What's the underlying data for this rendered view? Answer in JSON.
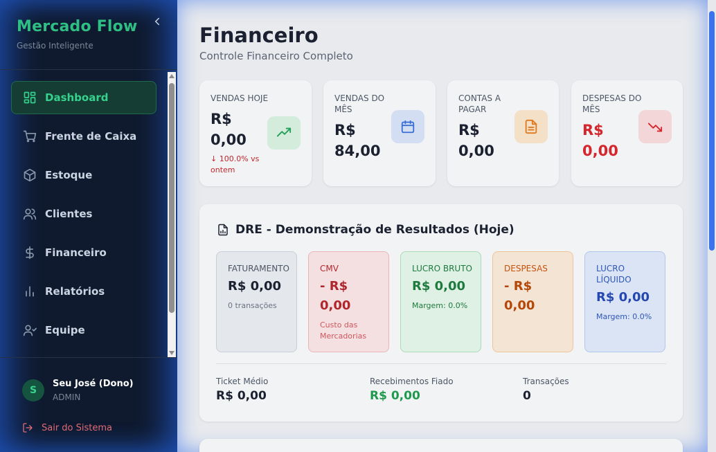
{
  "sidebar": {
    "brand_title": "Mercado Flow",
    "brand_subtitle": "Gestão Inteligente",
    "items": [
      {
        "label": "Dashboard",
        "icon": "dashboard-icon",
        "active": true
      },
      {
        "label": "Frente de Caixa",
        "icon": "cart-icon",
        "active": false
      },
      {
        "label": "Estoque",
        "icon": "box-icon",
        "active": false
      },
      {
        "label": "Clientes",
        "icon": "users-icon",
        "active": false
      },
      {
        "label": "Financeiro",
        "icon": "dollar-icon",
        "active": false
      },
      {
        "label": "Relatórios",
        "icon": "bar-chart-icon",
        "active": false
      },
      {
        "label": "Equipe",
        "icon": "team-icon",
        "active": false
      }
    ],
    "user": {
      "initial": "S",
      "name": "Seu José (Dono)",
      "role": "ADMIN"
    },
    "logout_label": "Sair do Sistema"
  },
  "header": {
    "title": "Financeiro",
    "subtitle": "Controle Financeiro Completo"
  },
  "kpis": [
    {
      "label": "VENDAS HOJE",
      "value_line1": "R$",
      "value_line2": "0,00",
      "trend": "↓ 100.0% vs ontem",
      "icon": "trending-up-icon",
      "color": "#22a05a"
    },
    {
      "label": "VENDAS DO MÊS",
      "value_line1": "R$",
      "value_line2": "84,00",
      "icon": "calendar-icon",
      "color": "#3b6fd6"
    },
    {
      "label": "CONTAS A PAGAR",
      "value_line1": "R$",
      "value_line2": "0,00",
      "icon": "document-icon",
      "color": "#e07a1f"
    },
    {
      "label": "DESPESAS DO MÊS",
      "value_line1": "R$",
      "value_line2": "0,00",
      "icon": "trending-down-icon",
      "color": "#d4262c"
    }
  ],
  "dre": {
    "title": "DRE - Demonstração de Resultados (Hoje)",
    "boxes": [
      {
        "label": "FATURAMENTO",
        "value_line1": "R$ 0,00",
        "value_line2": "",
        "note": "0 transações"
      },
      {
        "label": "CMV",
        "value_line1": "- R$",
        "value_line2": "0,00",
        "note": "Custo das Mercadorias"
      },
      {
        "label": "LUCRO BRUTO",
        "value_line1": "R$ 0,00",
        "value_line2": "",
        "note": "Margem: 0.0%"
      },
      {
        "label": "DESPESAS",
        "value_line1": "- R$",
        "value_line2": "0,00",
        "note": ""
      },
      {
        "label": "LUCRO LÍQUIDO",
        "value_line1": "R$ 0,00",
        "value_line2": "",
        "note": "Margem: 0.0%"
      }
    ],
    "footer": [
      {
        "label": "Ticket Médio",
        "value": "R$ 0,00"
      },
      {
        "label": "Recebimentos Fiado",
        "value": "R$ 0,00"
      },
      {
        "label": "Transações",
        "value": "0"
      }
    ]
  },
  "colors": {
    "brand": "#2fbf84",
    "sidebar_bg": "#0f1a2e",
    "main_bg": "#e8eaee",
    "positive": "#1f9a4d",
    "negative": "#c0272d"
  }
}
